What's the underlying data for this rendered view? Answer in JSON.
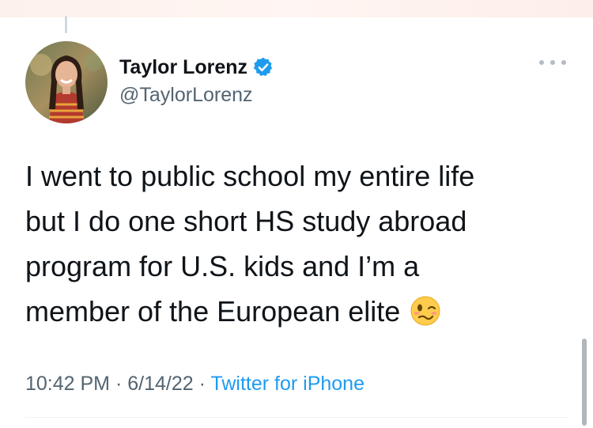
{
  "author": {
    "display_name": "Taylor Lorenz",
    "handle": "@TaylorLorenz",
    "verified": true
  },
  "tweet": {
    "lines": [
      "I went to public school my entire life",
      "but I do one short HS study abroad",
      "program for U.S. kids and I’m a",
      "member of the European elite"
    ],
    "emoji": "woozy-face"
  },
  "meta": {
    "time": "10:42 PM",
    "separator": "·",
    "date": "6/14/22",
    "source": "Twitter for iPhone"
  },
  "colors": {
    "text": "#0f1419",
    "secondary": "#536471",
    "accent": "#1d9bf0"
  },
  "icons": {
    "verified": "verified-badge-icon",
    "more": "more-options-icon"
  }
}
